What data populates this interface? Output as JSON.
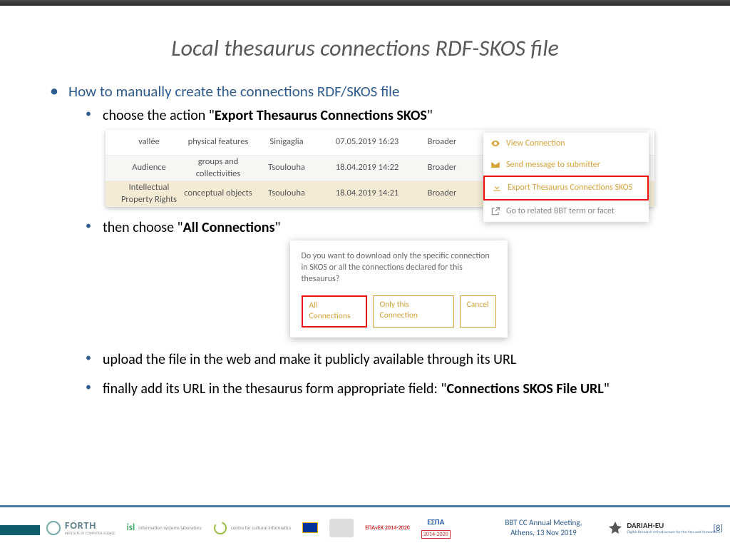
{
  "title": "Local thesaurus connections RDF-SKOS file",
  "bullet_main": "How to manually create the connections RDF/SKOS file",
  "step1_pre": "choose the action \"",
  "step1_bold": "Export Thesaurus Connections SKOS",
  "step1_post": "\"",
  "table": {
    "rows": [
      {
        "a": "vallée",
        "b": "physical features",
        "c": "Sinigaglia",
        "d": "07.05.2019 16:23",
        "e": "Broader"
      },
      {
        "a": "Audience",
        "b": "groups and collectivities",
        "c": "Tsoulouha",
        "d": "18.04.2019 14:22",
        "e": "Broader"
      },
      {
        "a": "Intellectual Property Rights",
        "b": "conceptual objects",
        "c": "Tsoulouha",
        "d": "18.04.2019 14:21",
        "e": "Broader"
      }
    ]
  },
  "context_menu": {
    "view": "View Connection",
    "send": "Send message to submitter",
    "export": "Export Thesaurus Connections SKOS",
    "goto": "Go to related BBT term or facet"
  },
  "step2_pre": "then choose \"",
  "step2_bold": "All Connections",
  "step2_post": "\"",
  "dialog": {
    "msg": "Do you want to download only the specific connection in SKOS or all the connections declared for this thesaurus?",
    "all": "All Connections",
    "only": "Only this Connection",
    "cancel": "Cancel"
  },
  "step3": "upload the file in the web and make it publicly available through its URL",
  "step4_pre": "finally add its URL in the thesaurus form appropriate field: \"",
  "step4_bold": "Connections SKOS File URL",
  "step4_post": "\"",
  "footer": {
    "forth": "FORTH",
    "forth_sub": "INSTITUTE OF COMPUTER SCIENCE",
    "isl": "information systems laboratory",
    "cci": "centre for cultural informatics",
    "epanek": "ΕΠΑνΕΚ 2014-2020",
    "espa": "ΕΣΠΑ",
    "espa_y": "2014-2020",
    "meeting_l1": "BBT CC Annual Meeting,",
    "meeting_l2": "Athens, 13 Nov 2019",
    "dariah": "DARIAH-EU",
    "dariah_sub": "Digital Research Infrastructure for the Arts and Humanities",
    "page": "[8]"
  }
}
